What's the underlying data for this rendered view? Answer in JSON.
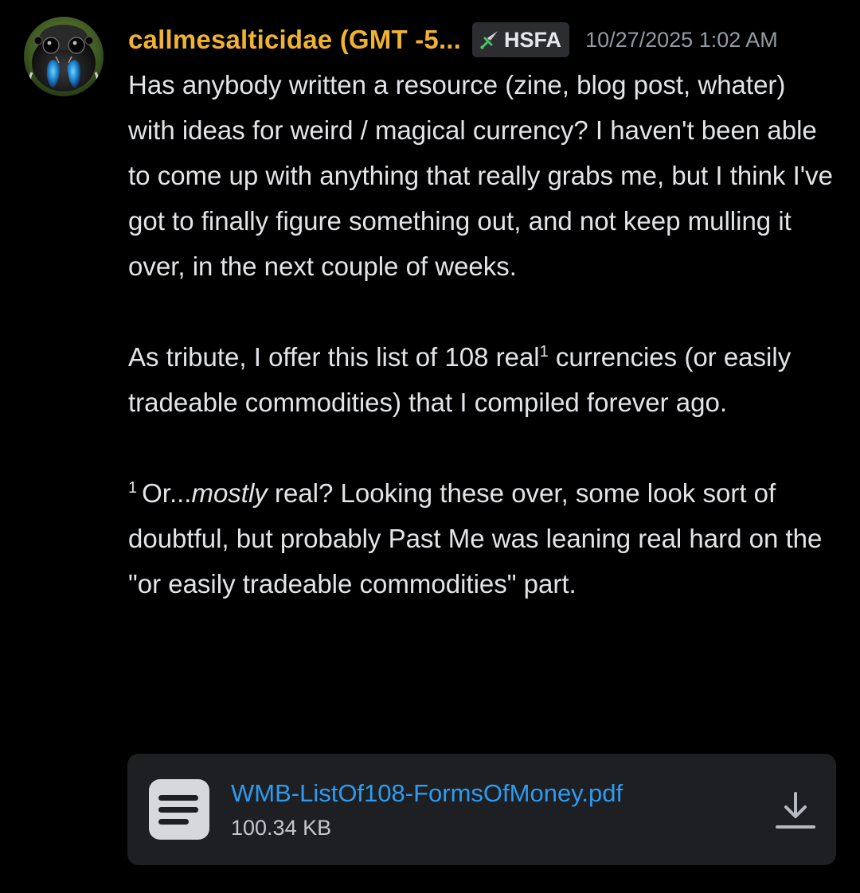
{
  "message": {
    "author": {
      "display_name": "callmesalticidae (GMT -5...",
      "name_color": "#f0b232",
      "avatar": "jumping-spider-avatar"
    },
    "role_tag": {
      "icon": "sword-icon",
      "label": "HSFA"
    },
    "timestamp": "10/27/2025 1:02 AM",
    "paragraphs": {
      "p1": "Has anybody written a resource (zine, blog post, whater) with ideas for weird / magical currency? I haven't been able to come up with anything that really grabs me, but I think I've got to finally figure something out, and not keep mulling it over, in the next couple of weeks.",
      "p2_before": "As tribute, I offer this list of 108 real",
      "p2_sup": "1",
      "p2_after": " currencies (or easily tradeable commodities) that I compiled forever ago.",
      "p3_mark": "1",
      "p3_before": "Or...",
      "p3_em": "mostly",
      "p3_after": " real? Looking these over, some look sort of doubtful, but probably Past Me was leaning real hard on the \"or easily tradeable commodities\" part."
    },
    "attachment": {
      "icon": "document-icon",
      "filename": "WMB-ListOf108-FormsOfMoney.pdf",
      "size": "100.34 KB",
      "action_icon": "download-icon",
      "link_color": "#2e9bf0"
    }
  }
}
